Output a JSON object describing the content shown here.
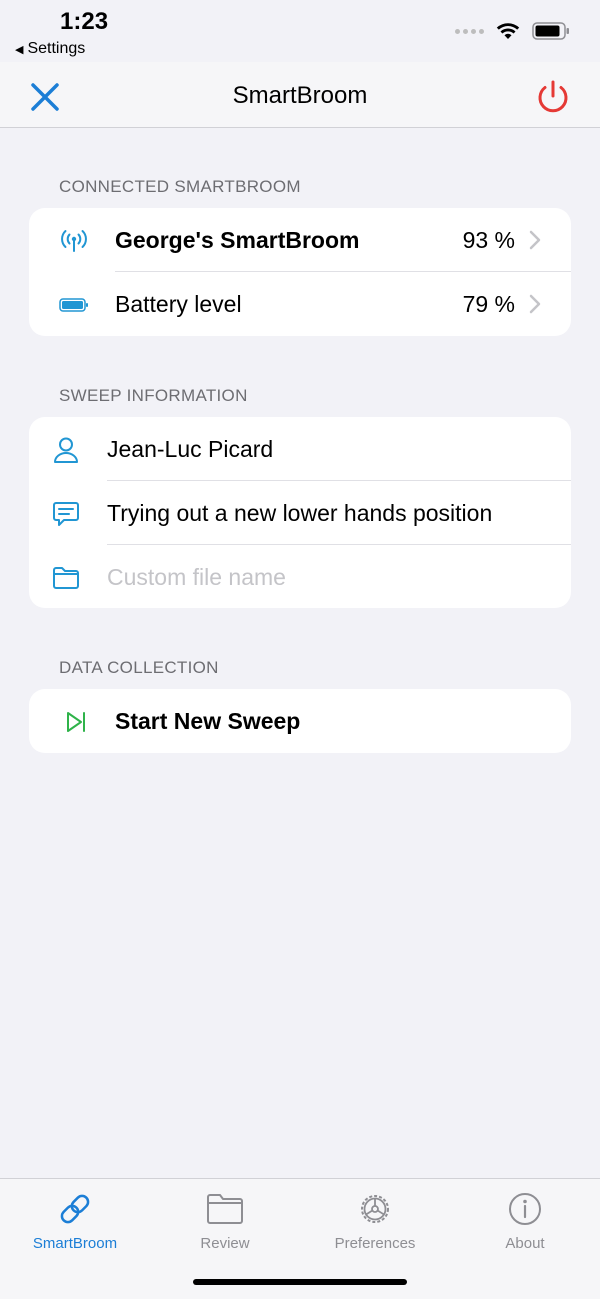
{
  "status_bar": {
    "time": "1:23",
    "back_app": "Settings"
  },
  "nav": {
    "title": "SmartBroom"
  },
  "sections": {
    "connected": {
      "header": "CONNECTED SMARTBROOM",
      "rows": [
        {
          "label": "George's SmartBroom",
          "value": "93 %",
          "icon": "antenna-icon"
        },
        {
          "label": "Battery level",
          "value": "79 %",
          "icon": "battery-icon"
        }
      ]
    },
    "sweep": {
      "header": "SWEEP INFORMATION",
      "user": {
        "value": "Jean-Luc Picard",
        "icon": "person-icon"
      },
      "comment": {
        "value": "Trying out a new lower hands position",
        "icon": "comment-icon"
      },
      "file": {
        "placeholder": "Custom file name",
        "value": "",
        "icon": "folder-icon"
      }
    },
    "data_collection": {
      "header": "DATA COLLECTION",
      "start_label": "Start New Sweep",
      "icon": "play-next-icon"
    }
  },
  "tabs": [
    {
      "label": "SmartBroom",
      "icon": "link-icon",
      "active": true
    },
    {
      "label": "Review",
      "icon": "folder-icon",
      "active": false
    },
    {
      "label": "Preferences",
      "icon": "gear-icon",
      "active": false
    },
    {
      "label": "About",
      "icon": "info-icon",
      "active": false
    }
  ],
  "colors": {
    "accent": "#1c7ed6",
    "power": "#e53935",
    "play": "#2fb34a",
    "background": "#f2f2f7",
    "secondary_text": "#6d6d72"
  }
}
